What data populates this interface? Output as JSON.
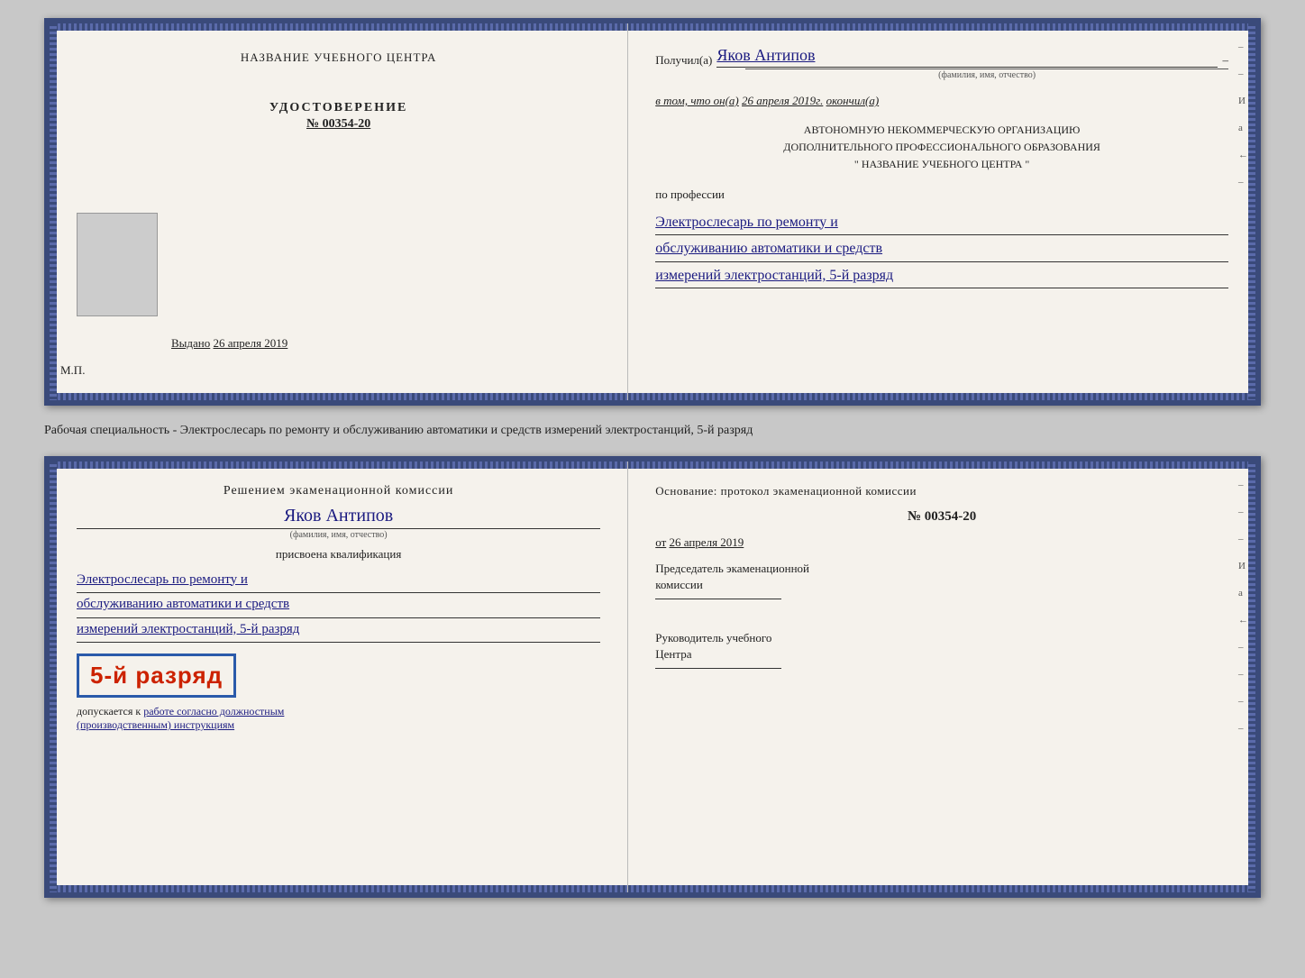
{
  "topCert": {
    "leftPanel": {
      "orgName": "НАЗВАНИЕ УЧЕБНОГО ЦЕНТРА",
      "certTitle": "УДОСТОВЕРЕНИЕ",
      "certNumber": "№ 00354-20",
      "issuedLabel": "Выдано",
      "issuedDate": "26 апреля 2019",
      "mpLabel": "М.П."
    },
    "rightPanel": {
      "receivedLabel": "Получил(а)",
      "recipientName": "Яков Антипов",
      "fioLabel": "(фамилия, имя, отчество)",
      "certifyLabel": "в том, что он(а)",
      "certifyDate": "26 апреля 2019г.",
      "completedLabel": "окончил(а)",
      "orgLine1": "АВТОНОМНУЮ НЕКОММЕРЧЕСКУЮ ОРГАНИЗАЦИЮ",
      "orgLine2": "ДОПОЛНИТЕЛЬНОГО ПРОФЕССИОНАЛЬНОГО ОБРАЗОВАНИЯ",
      "orgLine3": "\"   НАЗВАНИЕ УЧЕБНОГО ЦЕНТРА   \"",
      "professionLabel": "по профессии",
      "professionLine1": "Электрослесарь по ремонту и",
      "professionLine2": "обслуживанию автоматики и средств",
      "professionLine3": "измерений электростанций, 5-й разряд"
    }
  },
  "separatorText": "Рабочая специальность - Электрослесарь по ремонту и обслуживанию автоматики и средств измерений электростанций, 5-й разряд",
  "bottomCert": {
    "leftPanel": {
      "decisionTitle": "Решением экаменационной комиссии",
      "personName": "Яков Антипов",
      "fioLabel": "(фамилия, имя, отчество)",
      "qualificationLabel": "присвоена квалификация",
      "qualLine1": "Электрослесарь по ремонту и",
      "qualLine2": "обслуживанию автоматики и средств",
      "qualLine3": "измерений электростанций, 5-й разряд",
      "rankBadge": "5-й разряд",
      "allowedLabel": "допускается к",
      "allowedText": "работе согласно должностным",
      "allowedText2": "(производственным) инструкциям"
    },
    "rightPanel": {
      "basisLabel": "Основание: протокол экаменационной комиссии",
      "protocolNumber": "№  00354-20",
      "protocolDateLabel": "от",
      "protocolDate": "26 апреля 2019",
      "chairmanLabel": "Председатель экаменационной",
      "chairmanLabel2": "комиссии",
      "headLabel": "Руководитель учебного",
      "headLabel2": "Центра"
    }
  },
  "rightMarks": [
    "–",
    "–",
    "И",
    "а",
    "←",
    "–",
    "–",
    "–",
    "–"
  ],
  "rightMarks2": [
    "–",
    "–",
    "–",
    "И",
    "а",
    "←",
    "–",
    "–",
    "–",
    "–"
  ]
}
